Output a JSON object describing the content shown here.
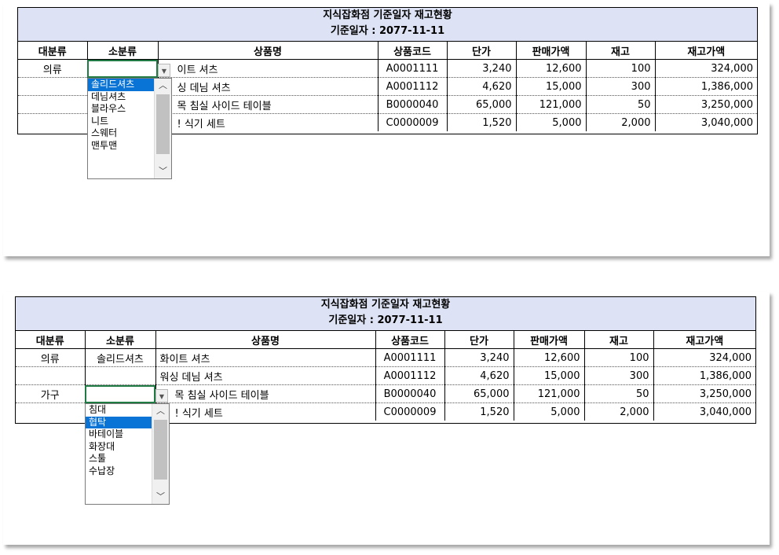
{
  "sheets": [
    {
      "title": "지식잡화점 기준일자 재고현황",
      "date_line": "기준일자 : 2077-11-11",
      "headers": [
        "대분류",
        "소분류",
        "상품명",
        "상품코드",
        "단가",
        "판매가액",
        "재고",
        "재고가액"
      ],
      "rows": [
        [
          "의류",
          "",
          "이트 셔츠",
          "A0001111",
          "3,240",
          "12,600",
          "100",
          "324,000"
        ],
        [
          "",
          "",
          "싱 데님 셔츠",
          "A0001112",
          "4,620",
          "15,000",
          "300",
          "1,386,000"
        ],
        [
          "",
          "",
          "목 침실 사이드 테이블",
          "B0000040",
          "65,000",
          "121,000",
          "50",
          "3,250,000"
        ],
        [
          "",
          "",
          "! 식기 세트",
          "C0000009",
          "1,520",
          "5,000",
          "2,000",
          "3,040,000"
        ]
      ],
      "dropdown": {
        "items": [
          "솔리드셔츠",
          "데님셔츠",
          "블라우스",
          "니트",
          "스웨터",
          "맨투맨"
        ],
        "selected_index": 0
      }
    },
    {
      "title": "지식잡화점 기준일자 재고현황",
      "date_line": "기준일자 : 2077-11-11",
      "headers": [
        "대분류",
        "소분류",
        "상품명",
        "상품코드",
        "단가",
        "판매가액",
        "재고",
        "재고가액"
      ],
      "rows": [
        [
          "의류",
          "솔리드셔츠",
          "화이트 셔츠",
          "A0001111",
          "3,240",
          "12,600",
          "100",
          "324,000"
        ],
        [
          "",
          "",
          "워싱 데님 셔츠",
          "A0001112",
          "4,620",
          "15,000",
          "300",
          "1,386,000"
        ],
        [
          "가구",
          "",
          "목 침실 사이드 테이블",
          "B0000040",
          "65,000",
          "121,000",
          "50",
          "3,250,000"
        ],
        [
          "",
          "",
          "! 식기 세트",
          "C0000009",
          "1,520",
          "5,000",
          "2,000",
          "3,040,000"
        ]
      ],
      "dropdown": {
        "items": [
          "침대",
          "협탁",
          "바테이블",
          "화장대",
          "스툴",
          "수납장"
        ],
        "selected_index": 1
      }
    }
  ]
}
